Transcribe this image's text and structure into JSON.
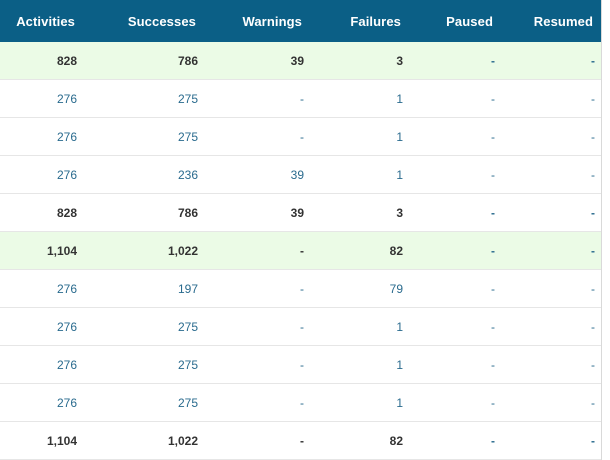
{
  "table": {
    "columns": [
      "Activities",
      "Successes",
      "Warnings",
      "Failures",
      "Paused",
      "Resumed"
    ],
    "rows": [
      {
        "kind": "summary",
        "highlight": true,
        "cells": [
          "828",
          "786",
          "39",
          "3",
          "-",
          "-"
        ]
      },
      {
        "kind": "detail",
        "highlight": false,
        "cells": [
          "276",
          "275",
          "-",
          "1",
          "-",
          "-"
        ]
      },
      {
        "kind": "detail",
        "highlight": false,
        "cells": [
          "276",
          "275",
          "-",
          "1",
          "-",
          "-"
        ]
      },
      {
        "kind": "detail",
        "highlight": false,
        "cells": [
          "276",
          "236",
          "39",
          "1",
          "-",
          "-"
        ]
      },
      {
        "kind": "summary",
        "highlight": false,
        "cells": [
          "828",
          "786",
          "39",
          "3",
          "-",
          "-"
        ]
      },
      {
        "kind": "summary",
        "highlight": true,
        "cells": [
          "1,104",
          "1,022",
          "-",
          "82",
          "-",
          "-"
        ]
      },
      {
        "kind": "detail",
        "highlight": false,
        "cells": [
          "276",
          "197",
          "-",
          "79",
          "-",
          "-"
        ]
      },
      {
        "kind": "detail",
        "highlight": false,
        "cells": [
          "276",
          "275",
          "-",
          "1",
          "-",
          "-"
        ]
      },
      {
        "kind": "detail",
        "highlight": false,
        "cells": [
          "276",
          "275",
          "-",
          "1",
          "-",
          "-"
        ]
      },
      {
        "kind": "detail",
        "highlight": false,
        "cells": [
          "276",
          "275",
          "-",
          "1",
          "-",
          "-"
        ]
      },
      {
        "kind": "summary",
        "highlight": false,
        "cells": [
          "1,104",
          "1,022",
          "-",
          "82",
          "-",
          "-"
        ]
      }
    ]
  },
  "colors": {
    "header_bg": "#0b5f86",
    "highlight_bg": "#ebfbe6",
    "link_text": "#2a6b8e",
    "summary_text": "#333333"
  }
}
